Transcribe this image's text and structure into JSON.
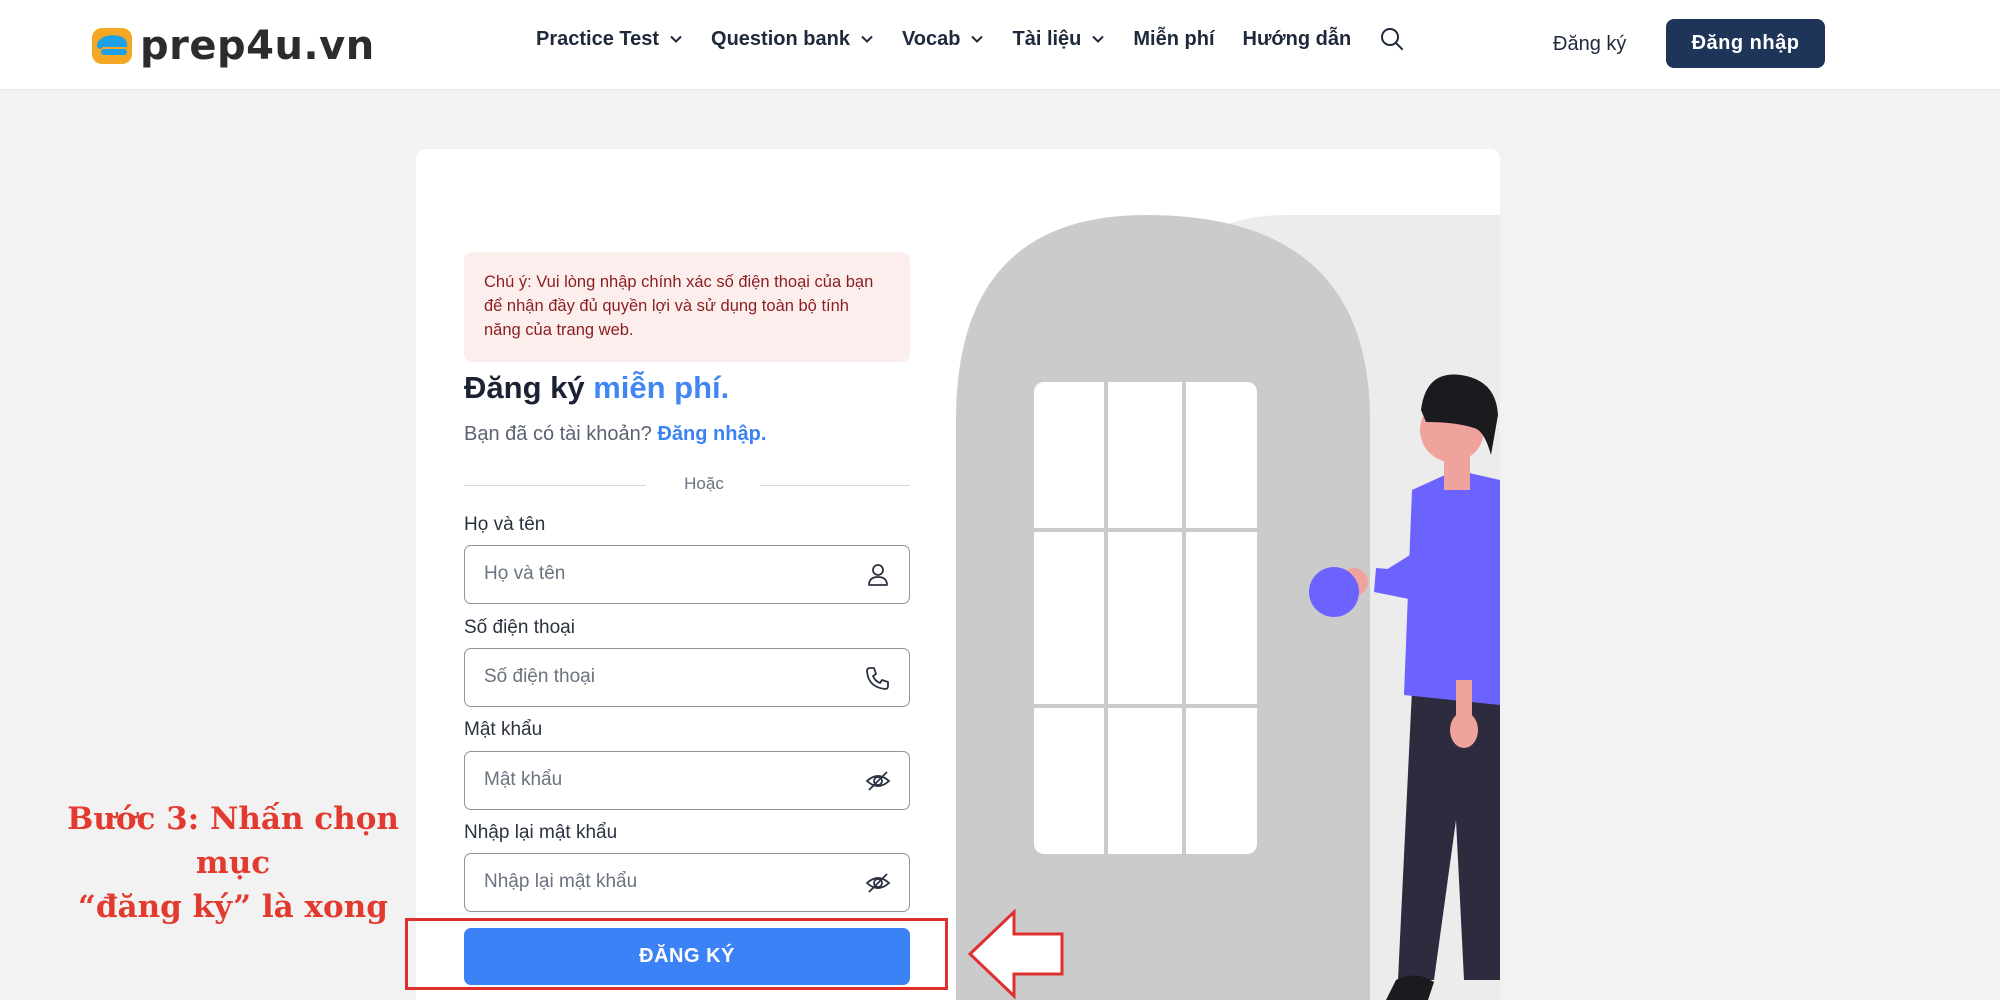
{
  "header": {
    "logo_text": "prep4u.vn",
    "nav": [
      {
        "label": "Practice Test",
        "has_dropdown": true
      },
      {
        "label": "Question bank",
        "has_dropdown": true
      },
      {
        "label": "Vocab",
        "has_dropdown": true
      },
      {
        "label": "Tài liệu",
        "has_dropdown": true
      },
      {
        "label": "Miễn phí",
        "has_dropdown": false
      },
      {
        "label": "Hướng dẫn",
        "has_dropdown": false
      }
    ],
    "register_label": "Đăng ký",
    "login_label": "Đăng nhập"
  },
  "form": {
    "notice": "Chú ý: Vui lòng nhập chính xác số điện thoại của bạn để nhận đầy đủ quyền lợi và sử dụng toàn bộ tính năng của trang web.",
    "title_main": "Đăng ký ",
    "title_highlight": "miễn phí.",
    "subtitle_text": "Bạn đã có tài khoản? ",
    "subtitle_link": "Đăng nhập.",
    "divider_text": "Hoặc",
    "fields": [
      {
        "label": "Họ và tên",
        "placeholder": "Họ và tên",
        "value": "",
        "icon": "user-icon"
      },
      {
        "label": "Số điện thoại",
        "placeholder": "Số điện thoại",
        "value": "",
        "icon": "phone-icon"
      },
      {
        "label": "Mật khẩu",
        "placeholder": "Mật khẩu",
        "value": "",
        "icon": "eye-off-icon"
      },
      {
        "label": "Nhập lại mật khẩu",
        "placeholder": "Nhập lại mật khẩu",
        "value": "",
        "icon": "eye-off-icon"
      }
    ],
    "submit_label": "ĐĂNG KÝ"
  },
  "annotation": {
    "line1": "Bước 3: Nhấn chọn mục",
    "line2": "“đăng ký” là xong"
  },
  "colors": {
    "primary": "#3b82f6",
    "navy": "#1e3458",
    "annotation_red": "#e23a2f",
    "notice_bg": "#fdeeee"
  }
}
